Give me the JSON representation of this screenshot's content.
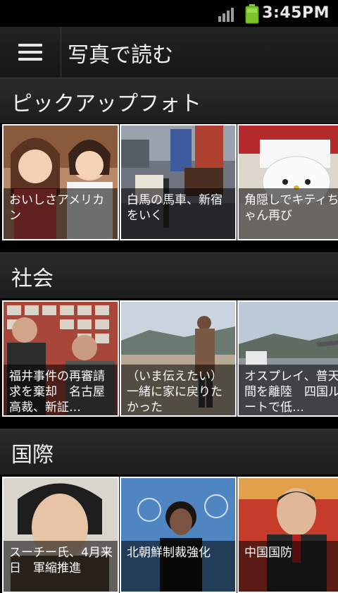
{
  "status_bar": {
    "time": "3:45PM"
  },
  "app_bar": {
    "title": "写真で読む"
  },
  "sections": [
    {
      "label": "ピックアップフォト",
      "items": [
        {
          "caption": "おいしさアメリカン"
        },
        {
          "caption": "白馬の馬車、新宿をいく"
        },
        {
          "caption": "角隠しでキティちゃん再び"
        }
      ]
    },
    {
      "label": "社会",
      "items": [
        {
          "caption": "福井事件の再審請求を棄却　名古屋高裁、新証…"
        },
        {
          "caption": "（いま伝えたい）一緒に家に戻りたかった"
        },
        {
          "caption": "オスプレイ、普天間を離陸　四国ルートで低…"
        }
      ]
    },
    {
      "label": "国際",
      "items": [
        {
          "caption": "スーチー氏、4月来日　軍縮推進"
        },
        {
          "caption": "北朝鮮制裁強化"
        },
        {
          "caption": "中国国防"
        }
      ]
    }
  ]
}
